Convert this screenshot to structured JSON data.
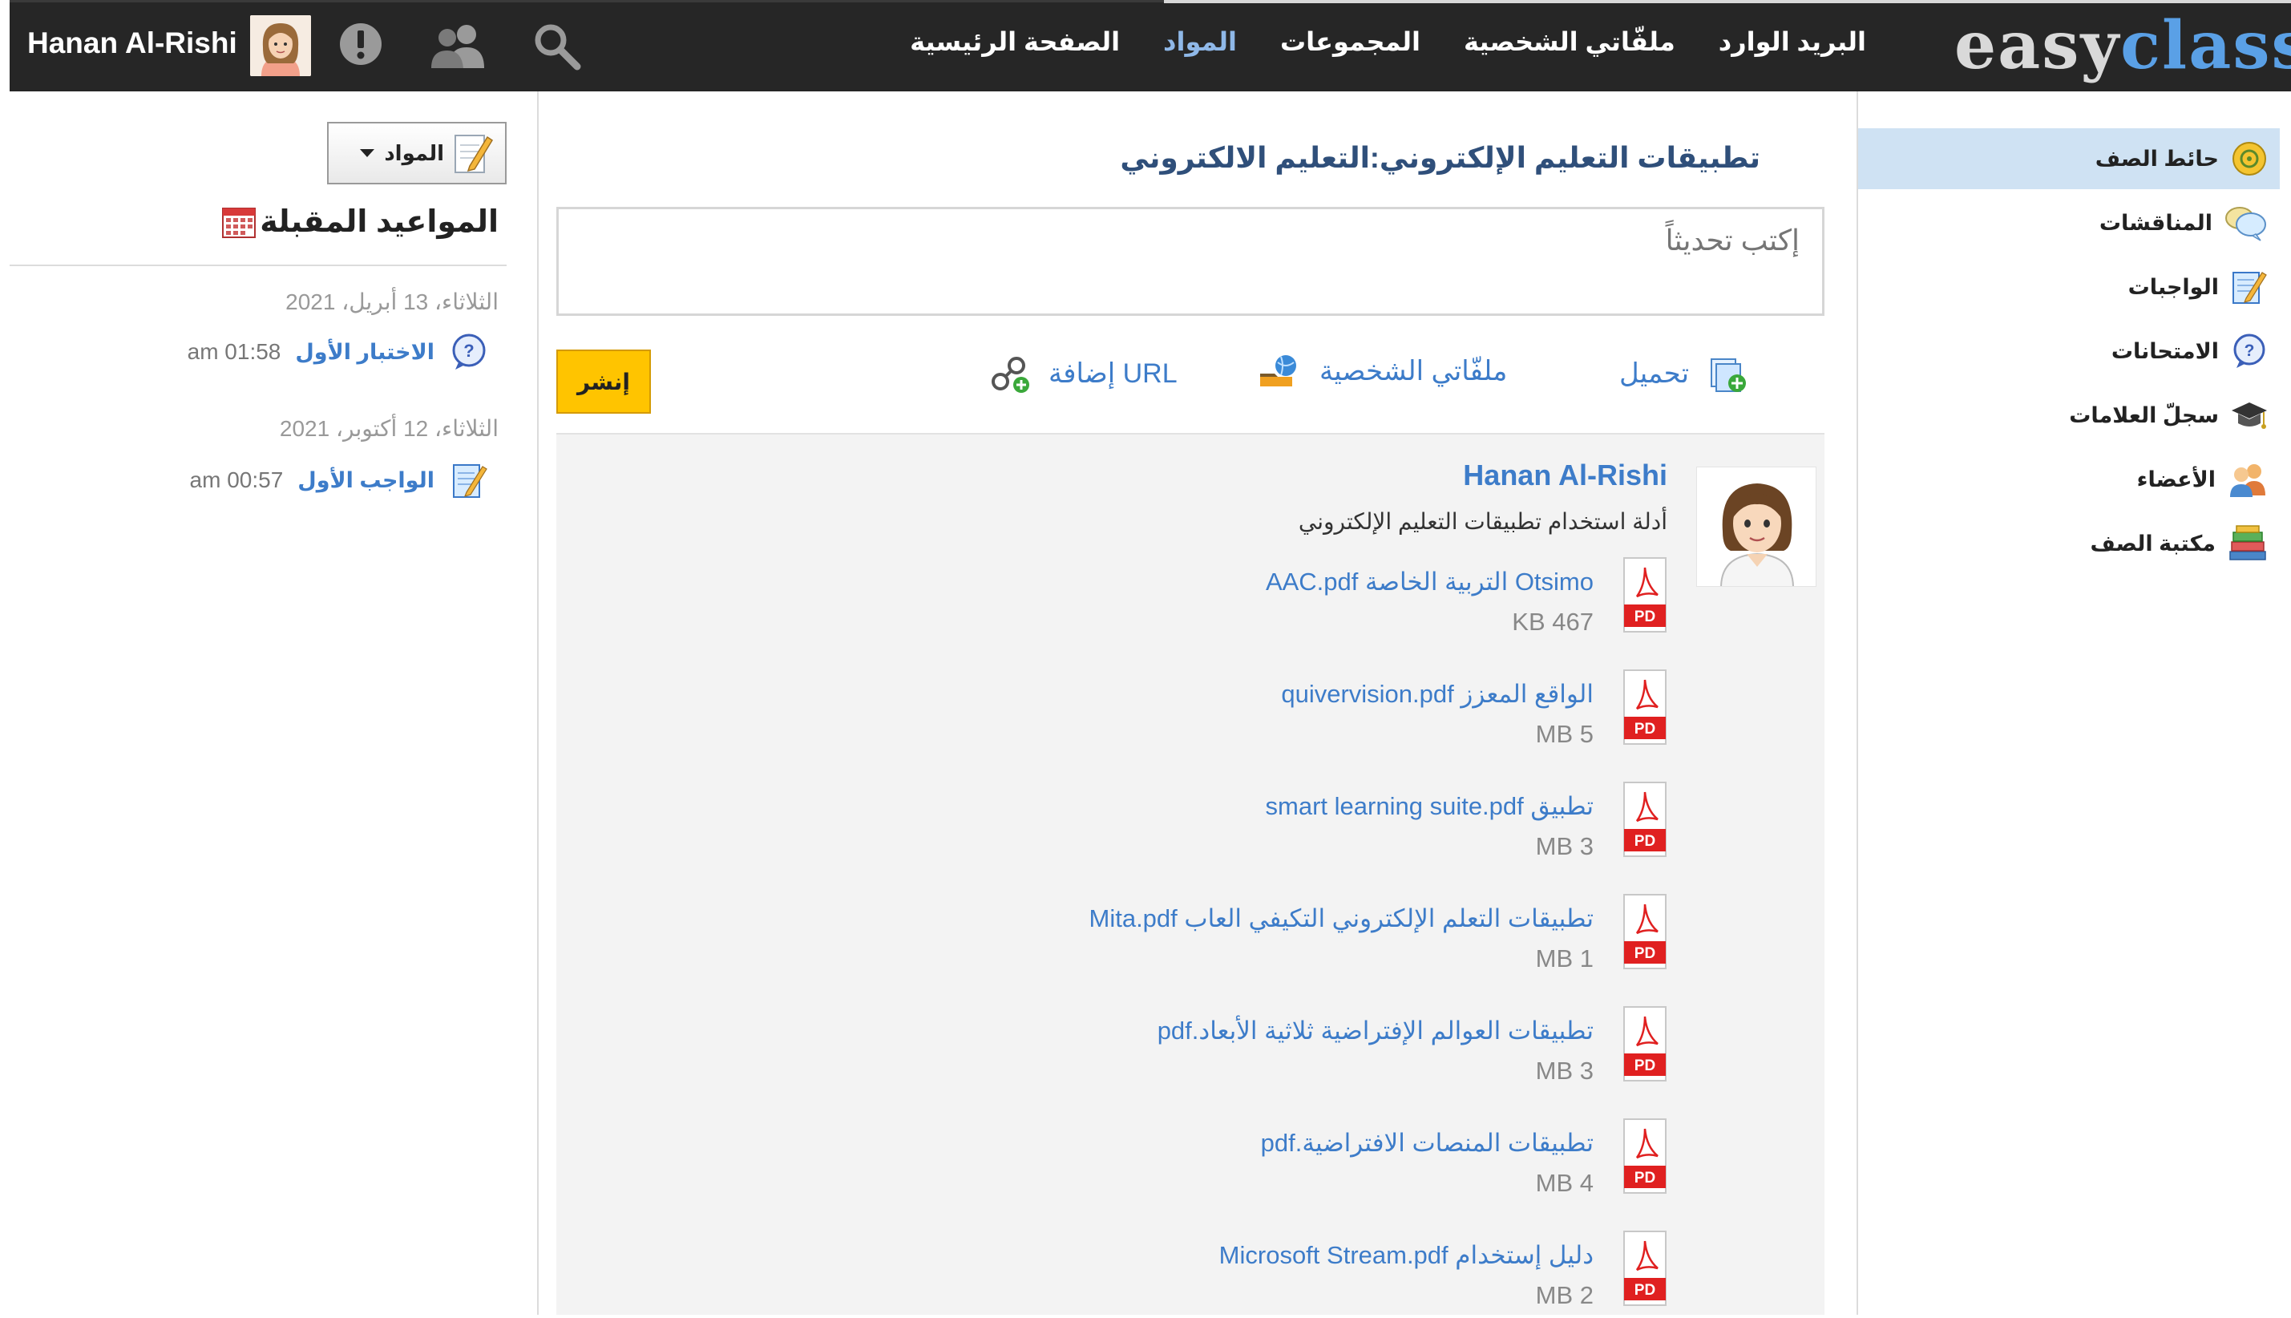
{
  "topbar": {
    "user_name": "Hanan Al-Rishi",
    "nav": [
      {
        "label": "الصفحة الرئيسية",
        "active": false
      },
      {
        "label": "المواد",
        "active": true
      },
      {
        "label": "المجموعات",
        "active": false
      },
      {
        "label": "ملفّاتي الشخصية",
        "active": false
      },
      {
        "label": "البريد الوارد",
        "active": false
      }
    ],
    "logo_left": "easy",
    "logo_right": "class"
  },
  "left": {
    "materials_button": "المواد",
    "upcoming_title": "المواعيد المقبلة",
    "events": [
      {
        "date": "الثلاثاء، 13 أبريل، 2021",
        "title": "الاختبار الأول",
        "time": "am 01:58",
        "icon": "quiz-question-icon"
      },
      {
        "date": "الثلاثاء، 12 أكتوبر، 2021",
        "title": "الواجب الأول",
        "time": "am 00:57",
        "icon": "assignment-icon"
      }
    ]
  },
  "sidebar": {
    "items": [
      {
        "label": "حائط الصف",
        "icon": "class-wall-icon",
        "active": true
      },
      {
        "label": "المناقشات",
        "icon": "discussions-icon",
        "active": false
      },
      {
        "label": "الواجبات",
        "icon": "assignments-icon",
        "active": false
      },
      {
        "label": "الامتحانات",
        "icon": "exams-icon",
        "active": false
      },
      {
        "label": "سجلّ العلامات",
        "icon": "gradebook-icon",
        "active": false
      },
      {
        "label": "الأعضاء",
        "icon": "members-icon",
        "active": false
      },
      {
        "label": "مكتبة الصف",
        "icon": "class-library-icon",
        "active": false
      }
    ]
  },
  "main": {
    "class_title": "تطبيقات التعليم الإلكتروني:التعليم الالكتروني",
    "update_placeholder": "إكتب تحديثاً",
    "tools": {
      "upload": "تحميل",
      "my_files": "ملفّاتي الشخصية",
      "add_url": "إضافة URL"
    },
    "post_button": "إنشر",
    "post": {
      "author": "Hanan Al-Rishi",
      "text": "أدلة استخدام تطبيقات التعليم الإلكتروني",
      "files": [
        {
          "name": "Otsimo التربية الخاصة AAC.pdf",
          "size": "KB 467"
        },
        {
          "name": "الواقع المعزز quivervision.pdf",
          "size": "MB 5"
        },
        {
          "name": "تطبيق smart learning suite.pdf",
          "size": "MB 3"
        },
        {
          "name": "تطبيقات التعلم الإلكتروني التكيفي العاب Mita.pdf",
          "size": "MB 1"
        },
        {
          "name": "تطبيقات العوالم الإفتراضية ثلاثية الأبعاد.pdf",
          "size": "MB 3"
        },
        {
          "name": "تطبيقات المنصات الافتراضية.pdf",
          "size": "MB 4"
        },
        {
          "name": "دليل إستخدام Microsoft Stream.pdf",
          "size": "MB 2"
        }
      ]
    }
  },
  "colors": {
    "topbar_bg": "#262626",
    "link_blue": "#3d7cc9",
    "active_nav": "#8fb8e8",
    "active_sidebar_bg": "#cfe2f3",
    "post_button_bg": "#ffc400",
    "pdf_red": "#e02020"
  }
}
